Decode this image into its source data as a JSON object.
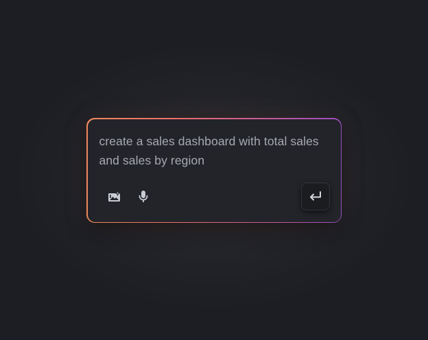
{
  "prompt": {
    "text": "create a sales dashboard with total sales and sales by region"
  },
  "toolbar": {
    "icons": {
      "image": "image-add-icon",
      "microphone": "microphone-icon",
      "submit": "enter-return-icon"
    }
  },
  "colors": {
    "border_gradient_start": "#f08a5d",
    "border_gradient_end": "#9a4fc0",
    "card_background": "#222429",
    "text": "#a7aab2",
    "icon": "#c9ccd3"
  }
}
